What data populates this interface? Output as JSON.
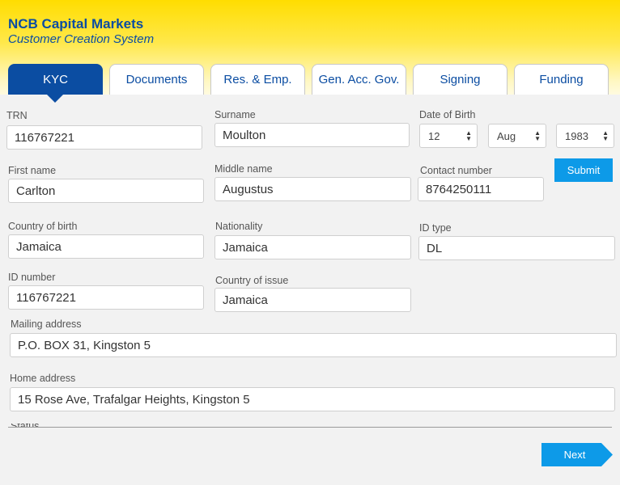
{
  "brand": {
    "title": "NCB Capital Markets",
    "subtitle": "Customer Creation System"
  },
  "tabs": [
    {
      "label": "KYC",
      "active": true
    },
    {
      "label": "Documents"
    },
    {
      "label": "Res. & Emp."
    },
    {
      "label": "Gen. Acc. Gov."
    },
    {
      "label": "Signing"
    },
    {
      "label": "Funding"
    }
  ],
  "form": {
    "trn": {
      "label": "TRN",
      "value": "116767221"
    },
    "surname": {
      "label": "Surname",
      "value": "Moulton"
    },
    "dob": {
      "label": "Date of Birth",
      "day": "12",
      "month": "Aug",
      "year": "1983"
    },
    "first_name": {
      "label": "First name",
      "value": "Carlton"
    },
    "middle_name": {
      "label": "Middle name",
      "value": "Augustus"
    },
    "contact": {
      "label": "Contact number",
      "value": "8764250111"
    },
    "country_birth": {
      "label": "Country of birth",
      "value": "Jamaica"
    },
    "nationality": {
      "label": "Nationality",
      "value": "Jamaica"
    },
    "id_type": {
      "label": "ID type",
      "value": "DL"
    },
    "id_number": {
      "label": "ID number",
      "value": "116767221"
    },
    "country_issue": {
      "label": "Country of issue",
      "value": "Jamaica"
    },
    "mailing": {
      "label": "Mailing address",
      "value": "P.O. BOX 31, Kingston 5"
    },
    "home": {
      "label": "Home address",
      "value": "15 Rose Ave, Trafalgar Heights, Kingston 5"
    },
    "status_cut": {
      "label": "Status"
    }
  },
  "buttons": {
    "submit": "Submit",
    "next": "Next"
  },
  "colors": {
    "brand_blue": "#0b4da2",
    "action_blue": "#0d9ae8",
    "header_yellow": "#ffdd00"
  }
}
